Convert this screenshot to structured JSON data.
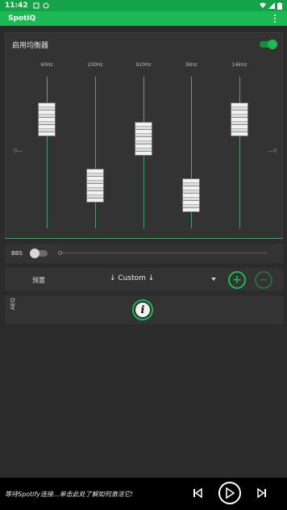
{
  "status_bar": {
    "time": "11:42"
  },
  "app_bar": {
    "title": "SpotiQ",
    "menu_icon": "more-vert-icon"
  },
  "equalizer": {
    "enable_label": "启用均衡器",
    "enabled": true,
    "zero_left": "0",
    "zero_right": "0",
    "bands": [
      {
        "label": "60Hz",
        "level": 0.72
      },
      {
        "label": "230Hz",
        "level": 0.28
      },
      {
        "label": "910Hz",
        "level": 0.59
      },
      {
        "label": "3kHz",
        "level": 0.22
      },
      {
        "label": "14kHz",
        "level": 0.72
      }
    ]
  },
  "bbs": {
    "label": "BBS",
    "enabled": false,
    "level": 0
  },
  "preset": {
    "label": "预置",
    "value": "↓ Custom ↓",
    "add_label": "+",
    "remove_label": "−"
  },
  "aeq": {
    "label": "AEQ",
    "info_label": "i"
  },
  "player": {
    "status": "等待Spotify连接...单击此处了解如何激活它!"
  },
  "colors": {
    "accent": "#1db954",
    "status_bar": "#15a349",
    "background": "#2b2b2b",
    "card": "#333333"
  }
}
